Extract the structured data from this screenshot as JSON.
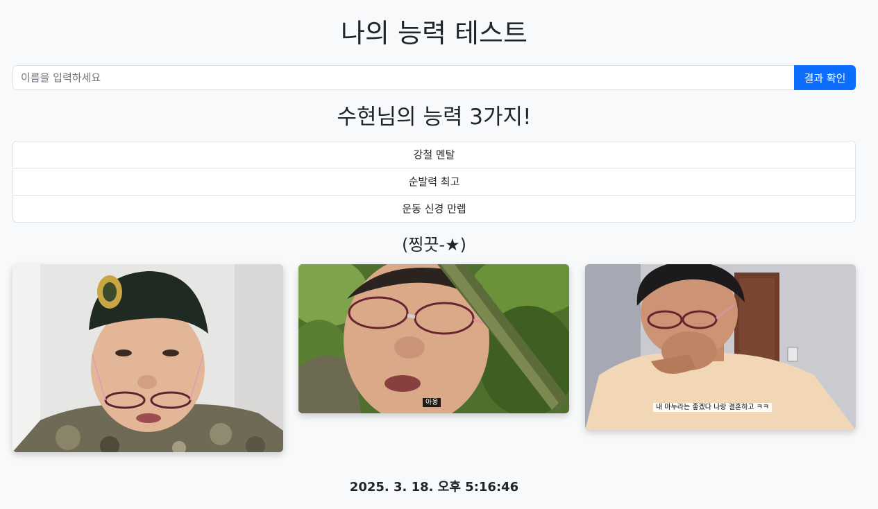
{
  "header": {
    "title": "나의 능력 테스트"
  },
  "form": {
    "name_placeholder": "이름을 입력하세요",
    "name_value": "",
    "submit_label": "결과 확인"
  },
  "result": {
    "heading": "수현님의 능력 3가지!",
    "abilities": [
      "강철 멘탈",
      "순발력 최고",
      "운동 신경 만렙"
    ],
    "subheading": "(찡끗-★)"
  },
  "photos": [
    {
      "caption": ""
    },
    {
      "caption": "아옹"
    },
    {
      "caption": "내 마누라는 좋겠다 나랑 결혼하고 ㅋㅋ"
    }
  ],
  "footer": {
    "timestamp": "2025. 3. 18. 오후 5:16:46"
  },
  "colors": {
    "primary": "#0d6efd",
    "page_background": "#f8f9fa",
    "border": "#dee2e6",
    "text": "#212529"
  }
}
